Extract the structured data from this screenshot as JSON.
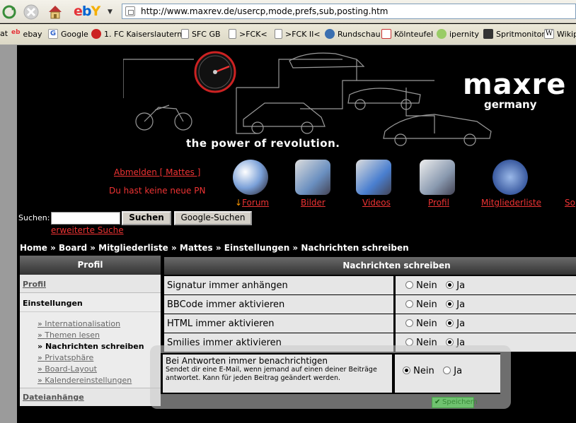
{
  "browser": {
    "url": "http://www.maxrev.de/usercp,mode,prefs,sub,posting.htm",
    "ebay_logo": "ebY"
  },
  "bookmarks": [
    {
      "label": "at",
      "icon": "folder-icon"
    },
    {
      "label": "ebay",
      "icon": "ebay-icon"
    },
    {
      "label": "Google",
      "icon": "google-icon"
    },
    {
      "label": "1. FC Kaiserslautern",
      "icon": "fck-icon"
    },
    {
      "label": "SFC GB",
      "icon": "page-icon"
    },
    {
      "label": ">FCK<",
      "icon": "page-icon"
    },
    {
      "label": ">FCK II<",
      "icon": "page-icon"
    },
    {
      "label": "Rundschau",
      "icon": "rundschau-icon"
    },
    {
      "label": "Kölnteufel",
      "icon": "koelnteufel-icon"
    },
    {
      "label": "ipernity",
      "icon": "ipernity-icon"
    },
    {
      "label": "Spritmonitor",
      "icon": "spritmonitor-icon"
    },
    {
      "label": "Wikip",
      "icon": "wikipedia-icon"
    }
  ],
  "header": {
    "logo": "maxre",
    "logo_sub": "germany",
    "slogan": "the power of revolution."
  },
  "user": {
    "logout": "Abmelden [ Mattes ]",
    "pm_status": "Du hast keine neue PN"
  },
  "nav": [
    {
      "label": "Forum",
      "icon": "forum-icon",
      "current": true
    },
    {
      "label": "Bilder",
      "icon": "bilder-folder-icon"
    },
    {
      "label": "Videos",
      "icon": "videos-folder-icon"
    },
    {
      "label": "Profil",
      "icon": "profil-folder-icon"
    },
    {
      "label": "Mitgliederliste",
      "icon": "mitglieder-icon"
    },
    {
      "label": "So",
      "icon": "more-icon"
    }
  ],
  "search": {
    "label": "Suchen:",
    "value": "",
    "button": "Suchen",
    "google_button": "Google-Suchen",
    "advanced": "erweiterte Suche"
  },
  "breadcrumb": "Home » Board » Mitgliederliste » Mattes » Einstellungen » Nachrichten schreiben",
  "left_panel": {
    "title": "Profil",
    "profil_link": "Profil",
    "settings_label": "Einstellungen",
    "items": [
      {
        "label": "Internationalisation",
        "current": false
      },
      {
        "label": "Themen lesen",
        "current": false
      },
      {
        "label": "Nachrichten schreiben",
        "current": true
      },
      {
        "label": "Privatsphäre",
        "current": false
      },
      {
        "label": "Board-Layout",
        "current": false
      },
      {
        "label": "Kalendereinstellungen",
        "current": false
      }
    ],
    "attachments": "Dateianhänge"
  },
  "main_panel": {
    "title": "Nachrichten schreiben",
    "options": [
      {
        "label": "Signatur immer anhängen",
        "no": "Nein",
        "yes": "Ja",
        "selected": "Ja"
      },
      {
        "label": "BBCode immer aktivieren",
        "no": "Nein",
        "yes": "Ja",
        "selected": "Ja"
      },
      {
        "label": "HTML immer aktivieren",
        "no": "Nein",
        "yes": "Ja",
        "selected": "Ja"
      },
      {
        "label": "Smilies immer aktivieren",
        "no": "Nein",
        "yes": "Ja",
        "selected": "Ja"
      }
    ],
    "highlight": {
      "label": "Bei Antworten immer benachrichtigen",
      "desc": "Sendet dir eine E-Mail, wenn jemand auf einen deiner Beiträge antwortet. Kann für jeden Beitrag geändert werden.",
      "no": "Nein",
      "yes": "Ja",
      "selected": "Nein"
    },
    "save_button": "Speichern"
  }
}
